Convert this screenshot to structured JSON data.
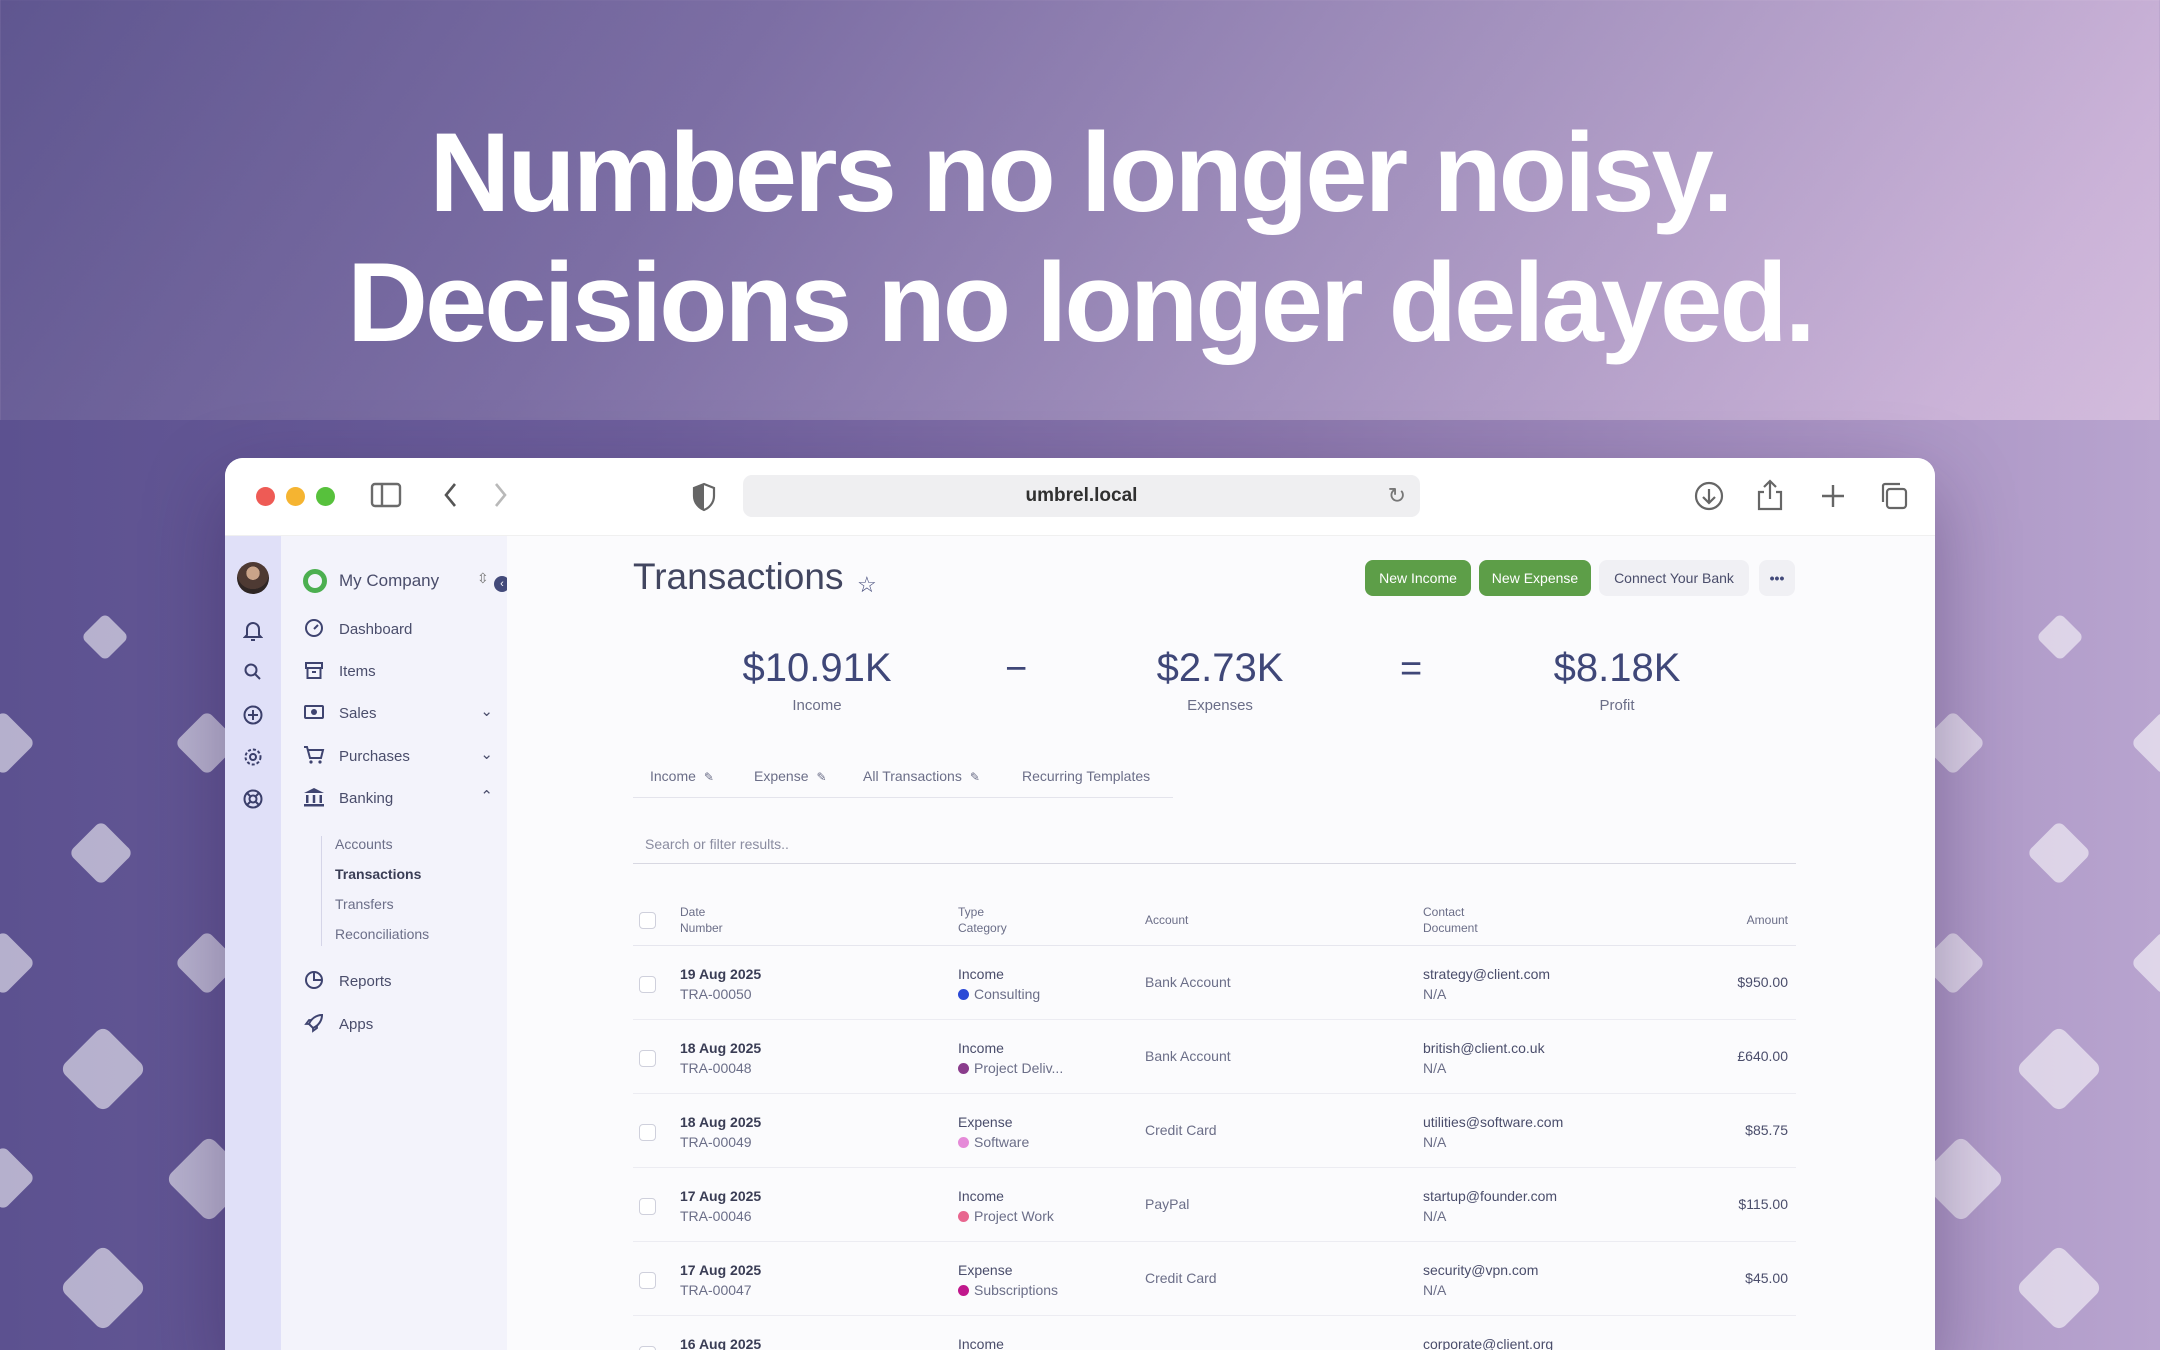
{
  "headline": {
    "line1": "Numbers no longer noisy.",
    "line2": "Decisions no longer delayed."
  },
  "browser": {
    "url": "umbrel.local"
  },
  "sidebar": {
    "company": "My Company",
    "items": [
      {
        "label": "Dashboard",
        "icon": "gauge-icon"
      },
      {
        "label": "Items",
        "icon": "archive-icon"
      },
      {
        "label": "Sales",
        "icon": "money-icon"
      },
      {
        "label": "Purchases",
        "icon": "cart-icon"
      },
      {
        "label": "Banking",
        "icon": "bank-icon"
      },
      {
        "label": "Reports",
        "icon": "pie-chart-icon"
      },
      {
        "label": "Apps",
        "icon": "rocket-icon"
      }
    ],
    "banking_sub": [
      "Accounts",
      "Transactions",
      "Transfers",
      "Reconciliations"
    ]
  },
  "page": {
    "title": "Transactions",
    "buttons": {
      "new_income": "New Income",
      "new_expense": "New Expense",
      "connect_bank": "Connect Your Bank",
      "more": "•••"
    }
  },
  "summary": {
    "income_value": "$10.91K",
    "income_label": "Income",
    "minus": "−",
    "expenses_value": "$2.73K",
    "expenses_label": "Expenses",
    "equals": "=",
    "profit_value": "$8.18K",
    "profit_label": "Profit"
  },
  "tabs": [
    "Income",
    "Expense",
    "All Transactions",
    "Recurring Templates"
  ],
  "search": {
    "placeholder": "Search or filter results.."
  },
  "table": {
    "headers": {
      "date": "Date",
      "number": "Number",
      "type": "Type",
      "category": "Category",
      "account": "Account",
      "contact": "Contact",
      "document": "Document",
      "amount": "Amount"
    },
    "rows": [
      {
        "date": "19 Aug 2025",
        "number": "TRA-00050",
        "type": "Income",
        "category": "Consulting",
        "category_color": "#2b49d6",
        "account": "Bank Account",
        "contact": "strategy@client.com",
        "document": "N/A",
        "amount": "$950.00"
      },
      {
        "date": "18 Aug 2025",
        "number": "TRA-00048",
        "type": "Income",
        "category": "Project Deliv...",
        "category_color": "#8a3c8c",
        "account": "Bank Account",
        "contact": "british@client.co.uk",
        "document": "N/A",
        "amount": "£640.00"
      },
      {
        "date": "18 Aug 2025",
        "number": "TRA-00049",
        "type": "Expense",
        "category": "Software",
        "category_color": "#e58ad8",
        "account": "Credit Card",
        "contact": "utilities@software.com",
        "document": "N/A",
        "amount": "$85.75"
      },
      {
        "date": "17 Aug 2025",
        "number": "TRA-00046",
        "type": "Income",
        "category": "Project Work",
        "category_color": "#e8668f",
        "account": "PayPal",
        "contact": "startup@founder.com",
        "document": "N/A",
        "amount": "$115.00"
      },
      {
        "date": "17 Aug 2025",
        "number": "TRA-00047",
        "type": "Expense",
        "category": "Subscriptions",
        "category_color": "#c0178c",
        "account": "Credit Card",
        "contact": "security@vpn.com",
        "document": "N/A",
        "amount": "$45.00"
      },
      {
        "date": "16 Aug 2025",
        "number": "",
        "type": "Income",
        "category": "",
        "category_color": "#2b49d6",
        "account": "",
        "contact": "corporate@client.org",
        "document": "",
        "amount": ""
      }
    ]
  }
}
